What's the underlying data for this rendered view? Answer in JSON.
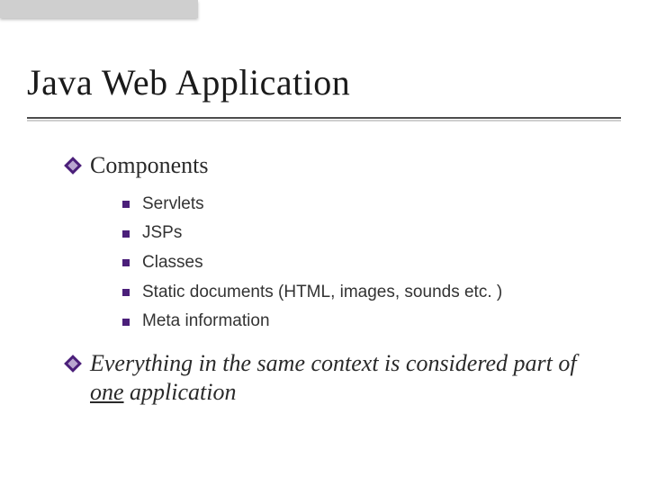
{
  "slide": {
    "title": "Java Web Application",
    "bullets": [
      {
        "text": "Components",
        "sub": [
          "Servlets",
          "JSPs",
          "Classes",
          "Static documents (HTML, images, sounds etc. )",
          "Meta information"
        ]
      },
      {
        "text_parts": {
          "pre": "Everything in the same context is considered part of ",
          "underlined": "one",
          "post": " application"
        },
        "italic": true
      }
    ]
  }
}
